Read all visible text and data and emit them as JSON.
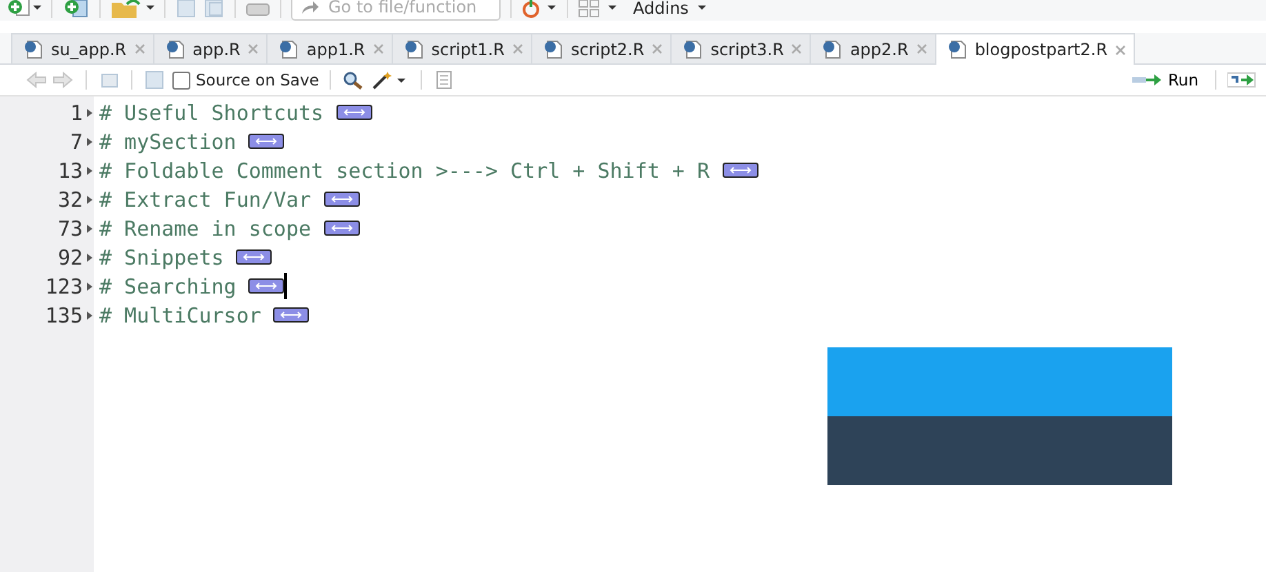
{
  "toolbar": {
    "search": {
      "placeholder": "Go to file/function"
    },
    "addins": "Addins"
  },
  "tabs": [
    {
      "label": "su_app.R",
      "selected": false
    },
    {
      "label": "app.R",
      "selected": false
    },
    {
      "label": "app1.R",
      "selected": false
    },
    {
      "label": "script1.R",
      "selected": false
    },
    {
      "label": "script2.R",
      "selected": false
    },
    {
      "label": "script3.R",
      "selected": false
    },
    {
      "label": "app2.R",
      "selected": false
    },
    {
      "label": "blogpostpart2.R",
      "selected": true
    }
  ],
  "editor_toolbar": {
    "source_on_save": {
      "label": "Source on Save",
      "checked": false
    },
    "run": "Run"
  },
  "lines": [
    {
      "number": "1",
      "text": "# Useful Shortcuts",
      "cursor": false
    },
    {
      "number": "7",
      "text": "# mySection",
      "cursor": false
    },
    {
      "number": "13",
      "text": "# Foldable Comment section >---> Ctrl + Shift + R",
      "cursor": false
    },
    {
      "number": "32",
      "text": "# Extract Fun/Var",
      "cursor": false
    },
    {
      "number": "73",
      "text": "# Rename in scope",
      "cursor": false
    },
    {
      "number": "92",
      "text": "# Snippets",
      "cursor": false
    },
    {
      "number": "123",
      "text": "# Searching",
      "cursor": true
    },
    {
      "number": "135",
      "text": "# MultiCursor",
      "cursor": false
    }
  ]
}
